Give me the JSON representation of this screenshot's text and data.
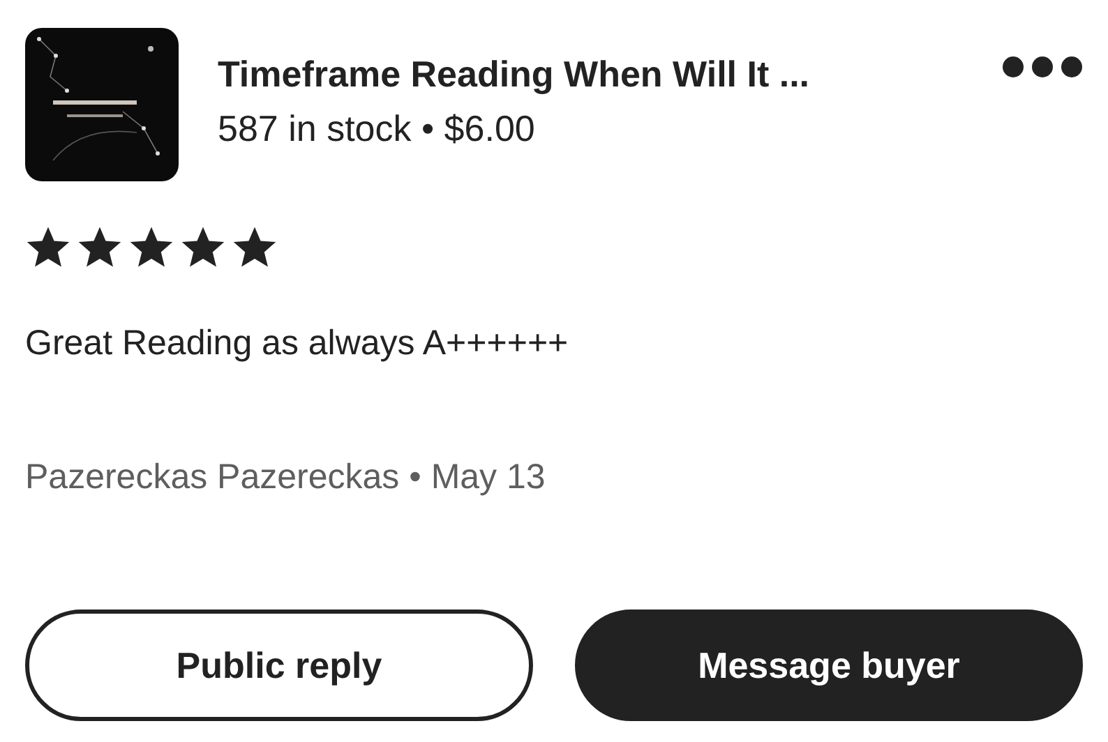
{
  "listing": {
    "title": "Timeframe Reading When Will It ...",
    "stock_price": "587 in stock • $6.00"
  },
  "review": {
    "stars": 5,
    "text": "Great Reading as always A++++++",
    "byline": "Pazereckas Pazereckas • May 13"
  },
  "buttons": [
    {
      "label": "Public reply",
      "kind": "outline"
    },
    {
      "label": "Message buyer",
      "kind": "filled"
    }
  ]
}
